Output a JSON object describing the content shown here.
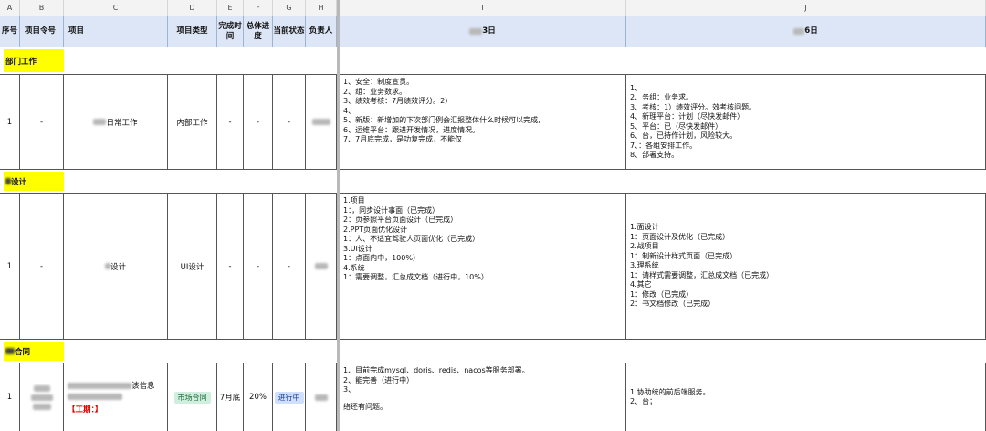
{
  "column_letters": [
    "A",
    "B",
    "C",
    "D",
    "E",
    "F",
    "G",
    "H",
    "I",
    "J"
  ],
  "headers": {
    "seq": "序号",
    "order": "项目令号",
    "project": "项目",
    "type": "项目类型",
    "done_time": "完成时间",
    "progress": "总体进度",
    "status": "当前状态",
    "owner": "负责人",
    "col_i": "3日",
    "col_j": "6日"
  },
  "sections": [
    {
      "label": "部门工作"
    },
    {
      "label": "设计"
    },
    {
      "label": "合同"
    }
  ],
  "rows": [
    {
      "seq": "1",
      "order": "-",
      "project": "日常工作",
      "type": "内部工作",
      "done_time": "-",
      "progress": "-",
      "status": "-",
      "col_i": [
        "1、安全：制度宣贯。",
        "2、组：业务数求。",
        "3、绩效考核：7月绩效评分。2）",
        "4、",
        "5、新版：新增加的下次部门例会汇报整体什么时候可以完成,",
        "6、运维平台：跟进开发情况，进度情况。",
        "7、7月底完成，是功复完成，不能仅"
      ],
      "col_j": [
        "1、",
        "2、务组：业务求。",
        "3、考核：1）绩效评分。效考核问题。",
        "4、新理平台：计划（尽快发邮件）",
        "5、平台：已（尽快发邮件）",
        "6、台，已持作计划，风险较大。",
        "7、：各组安排工作。",
        "8、部署支持。"
      ]
    },
    {
      "seq": "1",
      "order": "-",
      "project": "设计",
      "type": "UI设计",
      "done_time": "-",
      "progress": "-",
      "status": "-",
      "col_i": [
        "1.项目",
        "1：，同步设计事面（已完成）",
        "2：页参照平台页面设计（已完成）",
        "2.PPT页面优化设计",
        "1：人、不适宜驾驶人页面优化（已完成）",
        "3.UI设计",
        "1：点面内中，100%）",
        "4.系统",
        "1：需要调整，汇总成文档（进行中，10%）"
      ],
      "col_j": [
        "1.面设计",
        "1：页面设计及优化（已完成）",
        "2.战项目",
        "1：制新设计样式页面（已完成）",
        "3.理系统",
        "1：请样式需要调整，汇总成文档（已完成）",
        "4.其它",
        "1：修改（已完成）",
        "2：书文档修改（已完成）"
      ]
    },
    {
      "seq": "1",
      "order": "",
      "project_line1": "该信息",
      "project_red": "【工期：】",
      "type": "市场合同",
      "done_time": "7月底",
      "progress": "20%",
      "status": "进行中",
      "col_i": [
        "1、目前完成mysql、doris、redis、nacos等服务部署。",
        "2、能完善（进行中）",
        "3、",
        "",
        "络还有问题。"
      ],
      "col_j": [
        "1.协助统的前后端服务。",
        "2、台；"
      ]
    }
  ]
}
